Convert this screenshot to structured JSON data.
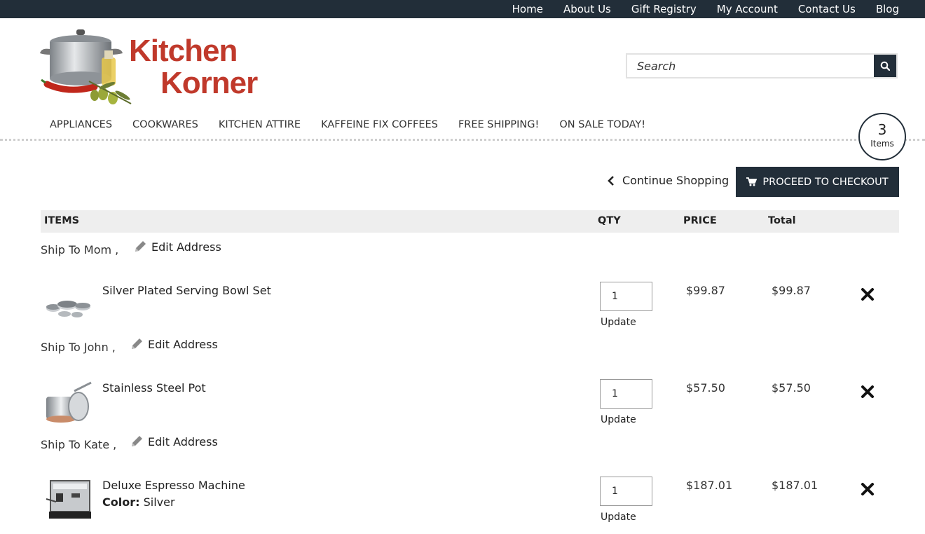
{
  "top_nav": [
    "Home",
    "About Us",
    "Gift Registry",
    "My Account",
    "Contact Us",
    "Blog"
  ],
  "logo": {
    "line1": "Kitchen",
    "line2": "Korner"
  },
  "search": {
    "placeholder": "Search"
  },
  "category_nav": [
    "APPLIANCES",
    "COOKWARES",
    "KITCHEN ATTIRE",
    "KAFFEINE FIX COFFEES",
    "FREE SHIPPING!",
    "ON SALE TODAY!"
  ],
  "cart": {
    "count": "3",
    "label": "Items"
  },
  "actions": {
    "continue": "Continue Shopping",
    "checkout": "PROCEED TO CHECKOUT"
  },
  "table_headers": {
    "items": "ITEMS",
    "qty": "QTY",
    "price": "PRICE",
    "total": "Total"
  },
  "edit_label": "Edit Address",
  "update_label": "Update",
  "colors": {
    "dark": "#222e39",
    "logo_red": "#c0392b",
    "header_bg": "#eeeeee"
  },
  "groups": [
    {
      "ship_to": "Ship To Mom ,",
      "product": "Silver Plated Serving Bowl Set",
      "attr_label": "",
      "attr_value": "",
      "qty": "1",
      "price": "$99.87",
      "total": "$99.87",
      "icon": "bowl-set-thumbnail"
    },
    {
      "ship_to": "Ship To John ,",
      "product": "Stainless Steel Pot",
      "attr_label": "",
      "attr_value": "",
      "qty": "1",
      "price": "$57.50",
      "total": "$57.50",
      "icon": "pot-thumbnail"
    },
    {
      "ship_to": "Ship To Kate ,",
      "product": "Deluxe Espresso Machine",
      "attr_label": "Color:",
      "attr_value": "Silver",
      "qty": "1",
      "price": "$187.01",
      "total": "$187.01",
      "icon": "espresso-machine-thumbnail"
    }
  ]
}
